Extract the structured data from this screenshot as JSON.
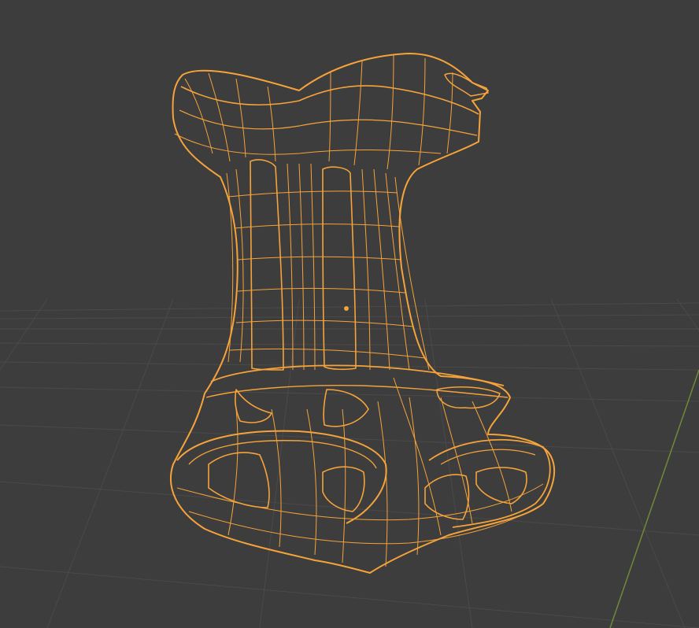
{
  "viewport": {
    "background_color": "#3d3d3d",
    "grid_color": "#4a4a4a",
    "y_axis_color": "#6e8a38",
    "selection_color": "#f5a33a",
    "selected_object": "wireframe-mesh",
    "shading_mode": "wireframe",
    "origin_marker": "object-origin-dot"
  }
}
